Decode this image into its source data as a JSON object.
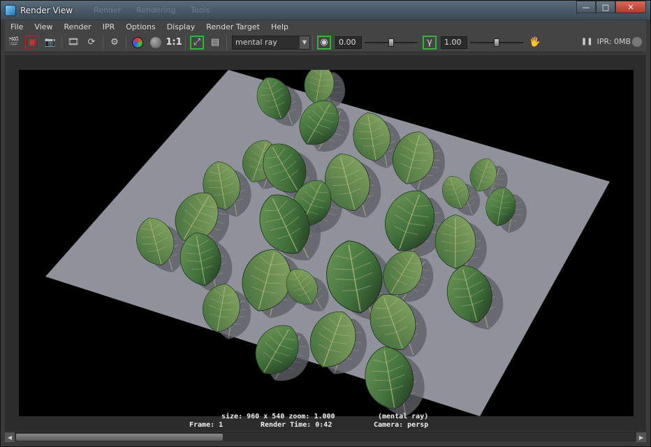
{
  "window": {
    "title": "Render View",
    "ghost_tabs": [
      "Render",
      "Rendering",
      "Tools"
    ],
    "controls": {
      "minimize": "—",
      "maximize": "□",
      "close": "✕"
    }
  },
  "menu": [
    "File",
    "View",
    "Render",
    "IPR",
    "Options",
    "Display",
    "Render Target",
    "Help"
  ],
  "toolbar": {
    "ratio_label": "1:1",
    "renderer": "mental ray",
    "exposure_value": "0.00",
    "gamma_value": "1.00",
    "exposure_slider": 0.5,
    "gamma_slider": 0.5,
    "ipr_status": "IPR: 0MB"
  },
  "hud": {
    "size_line": "size: 960 x 540 zoom: 1.000",
    "renderer_line": "(mental ray)",
    "frame_line": "Frame: 1",
    "time_line": "Render Time: 0:42",
    "camera_line": "Camera: persp"
  },
  "scroll": {
    "position": 0.0
  },
  "colors": {
    "plane": "#8f929a",
    "leaf": "#5a8a4a",
    "leaf_dark": "#223a22",
    "background": "#000000"
  }
}
